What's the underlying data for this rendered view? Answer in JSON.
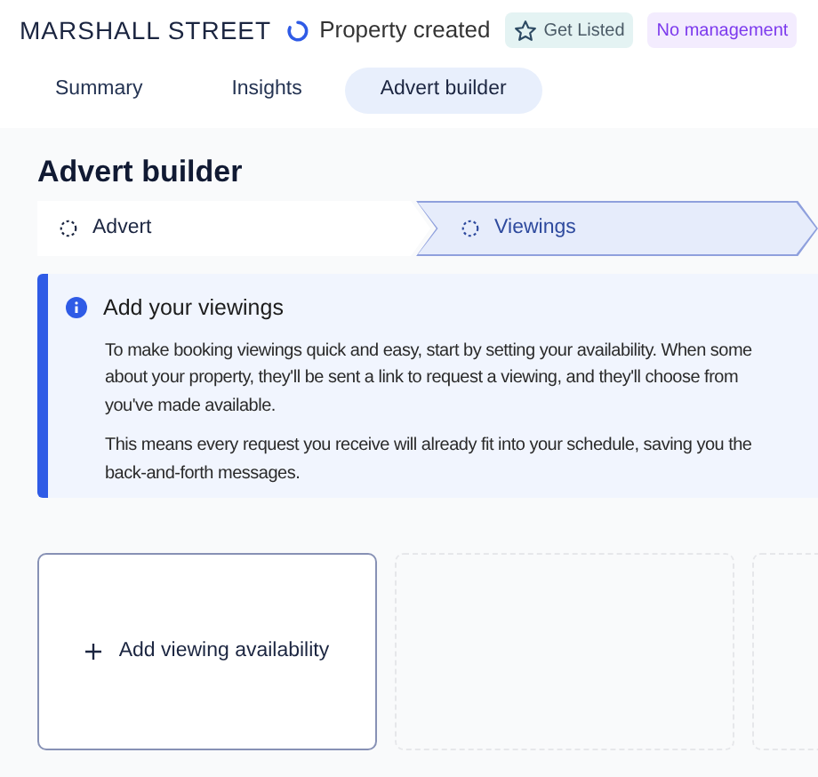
{
  "header": {
    "property_name": "MARSHALL STREET",
    "status": "Property created",
    "badges": [
      {
        "kind": "listing",
        "label": "Get Listed"
      },
      {
        "kind": "management",
        "label": "No management"
      }
    ]
  },
  "tabs": [
    {
      "label": "Summary",
      "selected": false
    },
    {
      "label": "Insights",
      "selected": false
    },
    {
      "label": "Advert builder",
      "selected": true
    }
  ],
  "page_title": "Advert builder",
  "steps": [
    {
      "label": "Advert",
      "selected": false
    },
    {
      "label": "Viewings",
      "selected": true
    }
  ],
  "info": {
    "title": "Add your viewings",
    "paragraphs": [
      [
        "To make booking viewings quick and easy, start by setting your availability. When some",
        "about your property, they'll be sent a link to request a viewing, and they'll choose from",
        "you've made available."
      ],
      [
        "This means every request you receive will already fit into your schedule, saving you the",
        "back-and-forth messages."
      ]
    ]
  },
  "slots": [
    {
      "kind": "add",
      "label": "Add viewing availability"
    },
    {
      "kind": "empty"
    },
    {
      "kind": "empty"
    }
  ]
}
